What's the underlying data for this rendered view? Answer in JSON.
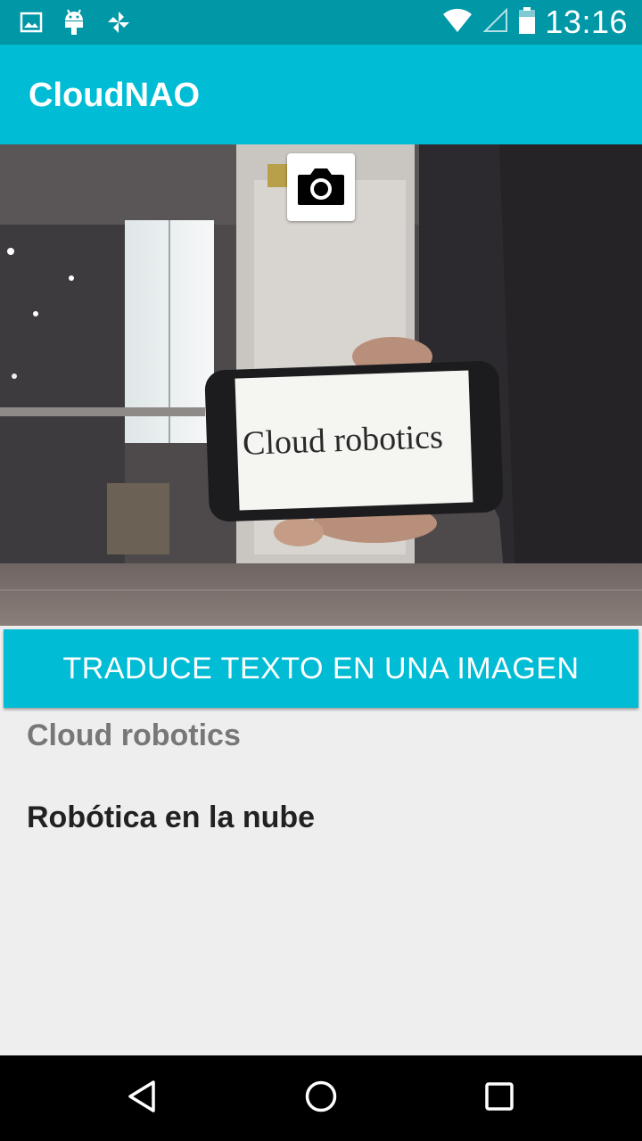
{
  "status_bar": {
    "time": "13:16",
    "left_icons": [
      "image-icon",
      "android-icon",
      "pinwheel-icon"
    ],
    "right_icons": [
      "wifi-icon",
      "signal-icon",
      "battery-icon"
    ]
  },
  "app_bar": {
    "title": "CloudNAO"
  },
  "photo": {
    "phone_text": "Cloud robotics",
    "camera_icon": "camera-icon"
  },
  "action": {
    "button_label": "TRADUCE TEXTO EN UNA IMAGEN"
  },
  "results": {
    "detected_text": "Cloud robotics",
    "translated_text": "Robótica en la nube"
  },
  "nav_bar": {
    "buttons": [
      "back-icon",
      "home-icon",
      "recents-icon"
    ]
  },
  "colors": {
    "accent": "#00bcd4",
    "status_bar": "#0097a7",
    "background": "#eeeeee"
  }
}
